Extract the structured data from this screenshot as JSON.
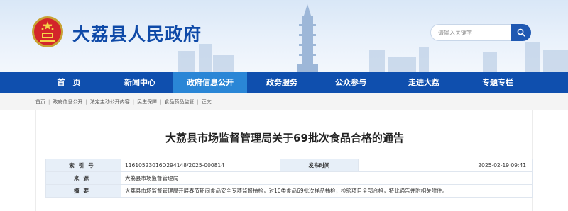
{
  "site": {
    "title": "大荔县人民政府",
    "search_placeholder": "请输入关键字"
  },
  "nav": {
    "items": [
      {
        "label": "首　页"
      },
      {
        "label": "新闻中心"
      },
      {
        "label": "政府信息公开"
      },
      {
        "label": "政务服务"
      },
      {
        "label": "公众参与"
      },
      {
        "label": "走进大荔"
      },
      {
        "label": "专题专栏"
      }
    ],
    "active_index": 2
  },
  "breadcrumb": [
    "首页",
    "政府信息公开",
    "法定主动公开内容",
    "民生保障",
    "食品药品监管",
    "正文"
  ],
  "article": {
    "title": "大荔县市场监督管理局关于69批次食品合格的通告",
    "meta": {
      "index_label": "索引号",
      "index_value": "11610523016O294148/2025-000814",
      "date_label": "发布时间",
      "date_value": "2025-02-19 09:41",
      "source_label": "来源",
      "source_value": "大荔县市场监督管理局",
      "abstract_label": "摘要",
      "abstract_value": "大荔县市场监督管理局开展春节期间食品安全专项监督抽检，对10类食品69批次样品抽检，检验项目全部合格，特此通告并附相关附件。"
    }
  },
  "colors": {
    "brand": "#0f4aa8",
    "nav_bg": "#0f4fae",
    "nav_active": "#2a86d6",
    "label_bg": "#e7eff8"
  },
  "icons": [
    "national-emblem-icon",
    "search-icon"
  ]
}
